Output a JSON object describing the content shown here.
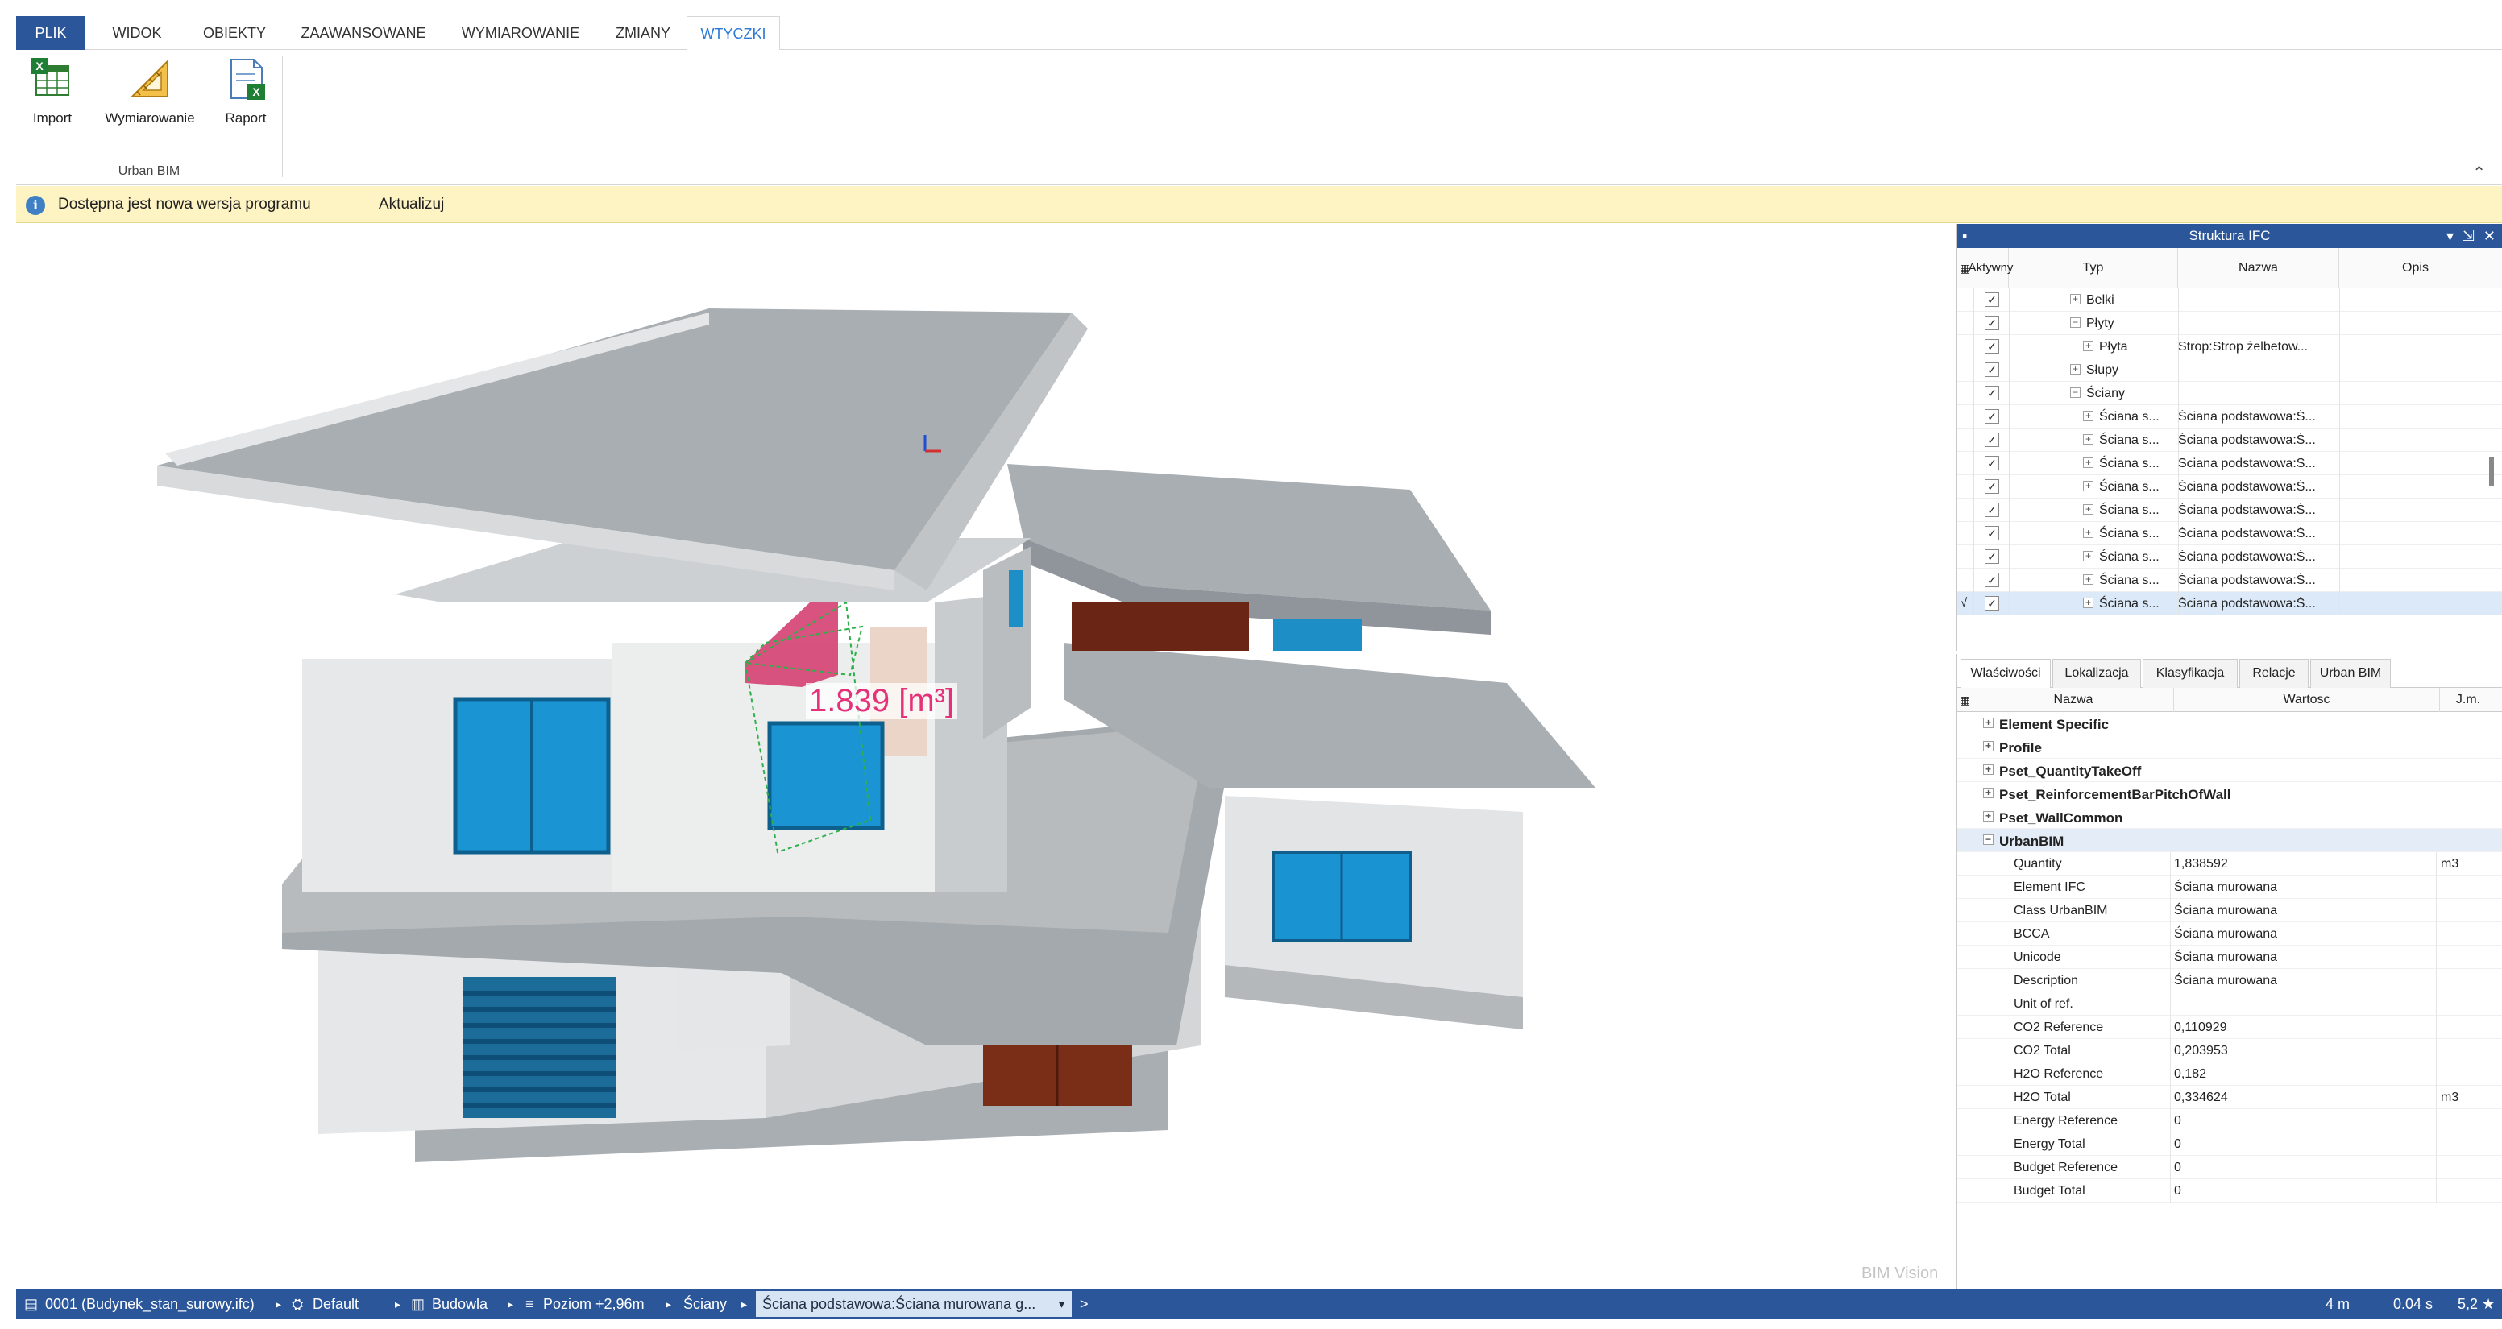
{
  "ribbon": {
    "tabs": [
      "PLIK",
      "WIDOK",
      "OBIEKTY",
      "ZAAWANSOWANE",
      "WYMIAROWANIE",
      "ZMIANY",
      "WTYCZKI"
    ],
    "active_tab": "WTYCZKI",
    "buttons": [
      {
        "label": "Import",
        "icon": "excel-import-icon"
      },
      {
        "label": "Wymiarowanie",
        "icon": "dimension-ruler-icon"
      },
      {
        "label": "Raport",
        "icon": "excel-report-icon"
      }
    ],
    "group_label": "Urban BIM",
    "collapse_glyph": "⌃"
  },
  "notification": {
    "message": "Dostępna jest nowa wersja programu",
    "action": "Aktualizuj",
    "icon": "info-icon"
  },
  "viewport": {
    "measurement_label": "1.839 [m³]",
    "watermark": "BIM Vision"
  },
  "ifc_panel": {
    "title": "Struktura IFC",
    "columns": {
      "active": "Aktywny",
      "type": "Typ",
      "name": "Nazwa",
      "desc": "Opis"
    },
    "rows": [
      {
        "type": "Belki",
        "name": "",
        "level": 1,
        "expander": "+",
        "checked": true,
        "selected": false
      },
      {
        "type": "Płyty",
        "name": "",
        "level": 1,
        "expander": "−",
        "checked": true,
        "selected": false
      },
      {
        "type": "Płyta",
        "name": "Strop:Strop żelbetow...",
        "level": 2,
        "expander": "+",
        "checked": true,
        "selected": false
      },
      {
        "type": "Słupy",
        "name": "",
        "level": 1,
        "expander": "+",
        "checked": true,
        "selected": false
      },
      {
        "type": "Ściany",
        "name": "",
        "level": 1,
        "expander": "−",
        "checked": true,
        "selected": false
      },
      {
        "type": "Ściana s...",
        "name": "Ściana podstawowa:Ś...",
        "level": 2,
        "expander": "+",
        "checked": true,
        "selected": false
      },
      {
        "type": "Ściana s...",
        "name": "Ściana podstawowa:Ś...",
        "level": 2,
        "expander": "+",
        "checked": true,
        "selected": false
      },
      {
        "type": "Ściana s...",
        "name": "Ściana podstawowa:Ś...",
        "level": 2,
        "expander": "+",
        "checked": true,
        "selected": false
      },
      {
        "type": "Ściana s...",
        "name": "Ściana podstawowa:Ś...",
        "level": 2,
        "expander": "+",
        "checked": true,
        "selected": false
      },
      {
        "type": "Ściana s...",
        "name": "Ściana podstawowa:Ś...",
        "level": 2,
        "expander": "+",
        "checked": true,
        "selected": false
      },
      {
        "type": "Ściana s...",
        "name": "Ściana podstawowa:Ś...",
        "level": 2,
        "expander": "+",
        "checked": true,
        "selected": false
      },
      {
        "type": "Ściana s...",
        "name": "Ściana podstawowa:Ś...",
        "level": 2,
        "expander": "+",
        "checked": true,
        "selected": false
      },
      {
        "type": "Ściana s...",
        "name": "Ściana podstawowa:Ś...",
        "level": 2,
        "expander": "+",
        "checked": true,
        "selected": false
      },
      {
        "type": "Ściana s...",
        "name": "Ściana podstawowa:Ś...",
        "level": 2,
        "expander": "+",
        "checked": true,
        "selected": true
      }
    ]
  },
  "properties": {
    "tabs": [
      "Właściwości",
      "Lokalizacja",
      "Klasyfikacja",
      "Relacje",
      "Urban BIM"
    ],
    "active_tab": "Właściwości",
    "columns": {
      "name": "Nazwa",
      "value": "Wartosc",
      "unit": "J.m."
    },
    "groups": [
      {
        "name": "Element Specific",
        "expander": "+"
      },
      {
        "name": "Profile",
        "expander": "+"
      },
      {
        "name": "Pset_QuantityTakeOff",
        "expander": "+"
      },
      {
        "name": "Pset_ReinforcementBarPitchOfWall",
        "expander": "+"
      },
      {
        "name": "Pset_WallCommon",
        "expander": "+"
      },
      {
        "name": "UrbanBIM",
        "expander": "−"
      }
    ],
    "rows": [
      {
        "name": "Quantity",
        "value": "1,838592",
        "unit": "m3"
      },
      {
        "name": "Element IFC",
        "value": "Ściana murowana",
        "unit": ""
      },
      {
        "name": "Class UrbanBIM",
        "value": "Ściana murowana",
        "unit": ""
      },
      {
        "name": "BCCA",
        "value": "Ściana murowana",
        "unit": ""
      },
      {
        "name": "Unicode",
        "value": "Ściana murowana",
        "unit": ""
      },
      {
        "name": "Description",
        "value": "Ściana murowana",
        "unit": ""
      },
      {
        "name": "Unit of ref.",
        "value": "",
        "unit": ""
      },
      {
        "name": "CO2 Reference",
        "value": "0,110929",
        "unit": ""
      },
      {
        "name": "CO2 Total",
        "value": "0,203953",
        "unit": ""
      },
      {
        "name": "H2O Reference",
        "value": "0,182",
        "unit": ""
      },
      {
        "name": "H2O Total",
        "value": "0,334624",
        "unit": "m3"
      },
      {
        "name": "Energy Reference",
        "value": "0",
        "unit": ""
      },
      {
        "name": "Energy Total",
        "value": "0",
        "unit": ""
      },
      {
        "name": "Budget Reference",
        "value": "0",
        "unit": ""
      },
      {
        "name": "Budget Total",
        "value": "0",
        "unit": ""
      }
    ]
  },
  "statusbar": {
    "file": "0001 (Budynek_stan_surowy.ifc)",
    "view": "Default",
    "building": "Budowla",
    "level": "Poziom +2,96m",
    "category": "Ściany",
    "element": "Ściana podstawowa:Ściana murowana g...",
    "arrow": ">",
    "distance": "4 m",
    "time": "0.04 s",
    "fps": "5,2 ★"
  },
  "colors": {
    "accent": "#2b579a",
    "notify_bg": "#fdf3c3",
    "highlight": "#e5317a",
    "glass": "#2a9fd6"
  }
}
